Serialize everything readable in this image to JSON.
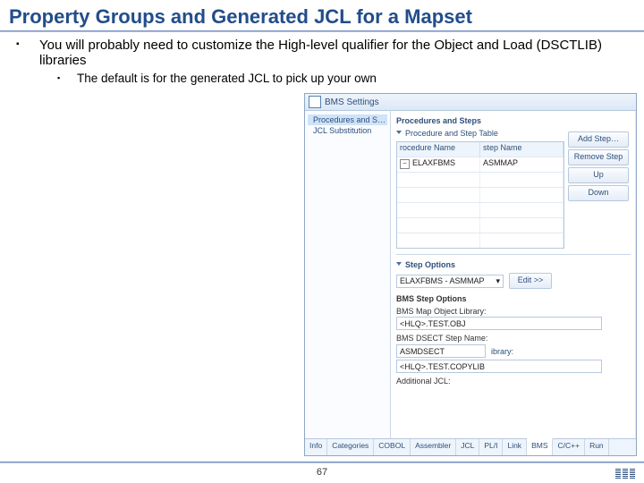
{
  "title": "Property Groups and Generated JCL for a Mapset",
  "bullets": {
    "l1": "You will probably need to customize the High-level qualifier for the Object and Load (DSCTLIB) libraries",
    "l2": "The default is for the generated JCL to pick up your own"
  },
  "panel": {
    "head": "BMS Settings",
    "nav": [
      "Procedures and Steps",
      "JCL Substitution"
    ],
    "section1": "Procedures and Steps",
    "subsection": "Procedure and Step Table",
    "table": {
      "headers": [
        "rocedure Name",
        "step Name"
      ],
      "row": [
        "ELAXFBMS",
        "ASMMAP"
      ]
    },
    "buttons": [
      "Add Step…",
      "Remove Step",
      "Up",
      "Down"
    ],
    "section2": "Step Options",
    "stepSel": "ELAXFBMS - ASMMAP",
    "editBtn": "Edit >>",
    "optTitle": "BMS Step Options",
    "f1l": "BMS Map Object Library:",
    "f1v": "<HLQ>.TEST.OBJ",
    "f2l": "BMS DSECT Step Name:",
    "f2v": "ASMDSECT",
    "f3l": "",
    "f3pre": "<HLQ>.TEST.COPYLIB",
    "sfx": "ibrary:",
    "f4l": "Additional JCL:",
    "tabs": [
      "Info",
      "Categories",
      "COBOL",
      "Assembler",
      "JCL",
      "PL/I",
      "Link",
      "BMS",
      "C/C++",
      "Run"
    ]
  },
  "page": "67"
}
